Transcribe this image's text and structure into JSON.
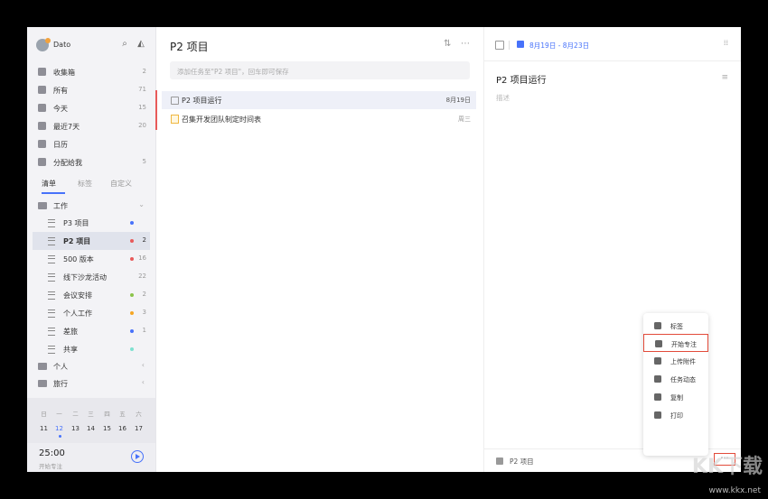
{
  "user": {
    "name": "Dato"
  },
  "nav": [
    {
      "label": "收集箱",
      "count": "2"
    },
    {
      "label": "所有",
      "count": "71"
    },
    {
      "label": "今天",
      "count": "15"
    },
    {
      "label": "最近7天",
      "count": "20"
    },
    {
      "label": "日历",
      "count": ""
    },
    {
      "label": "分配给我",
      "count": "5"
    }
  ],
  "tabs": [
    "清单",
    "标签",
    "自定义"
  ],
  "folders": {
    "work": "工作",
    "personal": "个人",
    "travel": "旅行"
  },
  "lists": [
    {
      "label": "P3 项目",
      "count": "",
      "color": "#4772fa"
    },
    {
      "label": "P2 项目",
      "count": "2",
      "color": "#e85a5a"
    },
    {
      "label": "500 版本",
      "count": "16",
      "color": "#e85a5a"
    },
    {
      "label": "线下沙龙活动",
      "count": "22",
      "color": ""
    },
    {
      "label": "会议安排",
      "count": "2",
      "color": "#8bc34a"
    },
    {
      "label": "个人工作",
      "count": "3",
      "color": "#f5a623"
    },
    {
      "label": "差旅",
      "count": "1",
      "color": "#4772fa"
    },
    {
      "label": "共享",
      "count": "",
      "color": "#7ee0d0"
    }
  ],
  "calendar": {
    "weekdays": [
      "日",
      "一",
      "二",
      "三",
      "四",
      "五",
      "六"
    ],
    "days": [
      "11",
      "12",
      "13",
      "14",
      "15",
      "16",
      "17"
    ]
  },
  "pomodoro": {
    "time": "25:00",
    "label": "开始专注"
  },
  "middle": {
    "title": "P2 项目",
    "add_placeholder": "添加任务至\"P2 项目\"，回车即可保存",
    "tasks": [
      {
        "label": "P2 项目运行",
        "date": "8月19日"
      },
      {
        "label": "召集开发团队制定时间表",
        "date": "周三"
      }
    ]
  },
  "detail": {
    "date_range": "8月19日 - 8月23日",
    "title": "P2 项目运行",
    "desc_placeholder": "描述",
    "list_name": "P2 项目"
  },
  "menu": [
    "标签",
    "开始专注",
    "上传附件",
    "任务动态",
    "复制",
    "打印"
  ],
  "watermark": {
    "brand": "KK下载",
    "url": "www.kkx.net"
  }
}
